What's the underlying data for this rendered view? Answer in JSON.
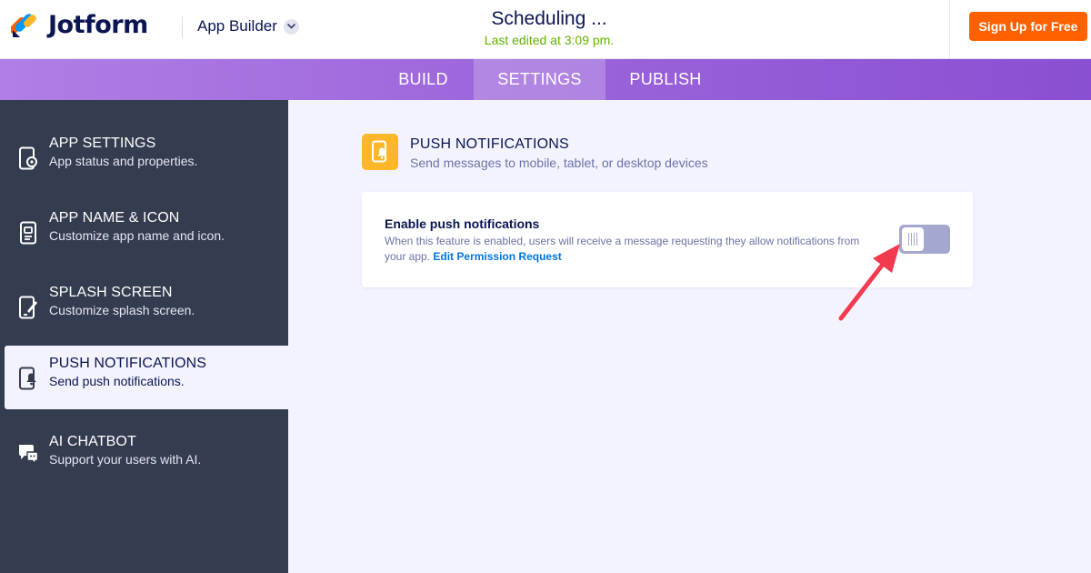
{
  "header": {
    "brand": "Jotform",
    "product": "App Builder",
    "doc_title": "Scheduling ...",
    "last_edited": "Last edited at 3:09 pm.",
    "signup_label": "Sign Up for Free"
  },
  "tabs": [
    {
      "label": "BUILD",
      "active": false
    },
    {
      "label": "SETTINGS",
      "active": true
    },
    {
      "label": "PUBLISH",
      "active": false
    }
  ],
  "sidebar": {
    "items": [
      {
        "title": "APP SETTINGS",
        "subtitle": "App status and properties.",
        "icon": "gear-phone-icon",
        "active": false
      },
      {
        "title": "APP NAME & ICON",
        "subtitle": "Customize app name and icon.",
        "icon": "app-name-icon",
        "active": false
      },
      {
        "title": "SPLASH SCREEN",
        "subtitle": "Customize splash screen.",
        "icon": "splash-screen-icon",
        "active": false
      },
      {
        "title": "PUSH NOTIFICATIONS",
        "subtitle": "Send push notifications.",
        "icon": "push-notification-icon",
        "active": true
      },
      {
        "title": "AI CHATBOT",
        "subtitle": "Support your users with AI.",
        "icon": "chatbot-icon",
        "active": false
      }
    ]
  },
  "content": {
    "section_title": "PUSH NOTIFICATIONS",
    "section_subtitle": "Send messages to mobile, tablet, or desktop devices",
    "card": {
      "title": "Enable push notifications",
      "description": "When this feature is enabled, users will receive a message requesting they allow notifications from your app.",
      "link": "Edit Permission Request",
      "toggle_on": false
    }
  },
  "colors": {
    "accent_orange": "#ff6100",
    "section_icon_bg": "#ffb629",
    "sidebar_bg": "#343c4f",
    "link_blue": "#0075e3",
    "edited_green": "#64b200",
    "annotation_red": "#f23a4f"
  }
}
